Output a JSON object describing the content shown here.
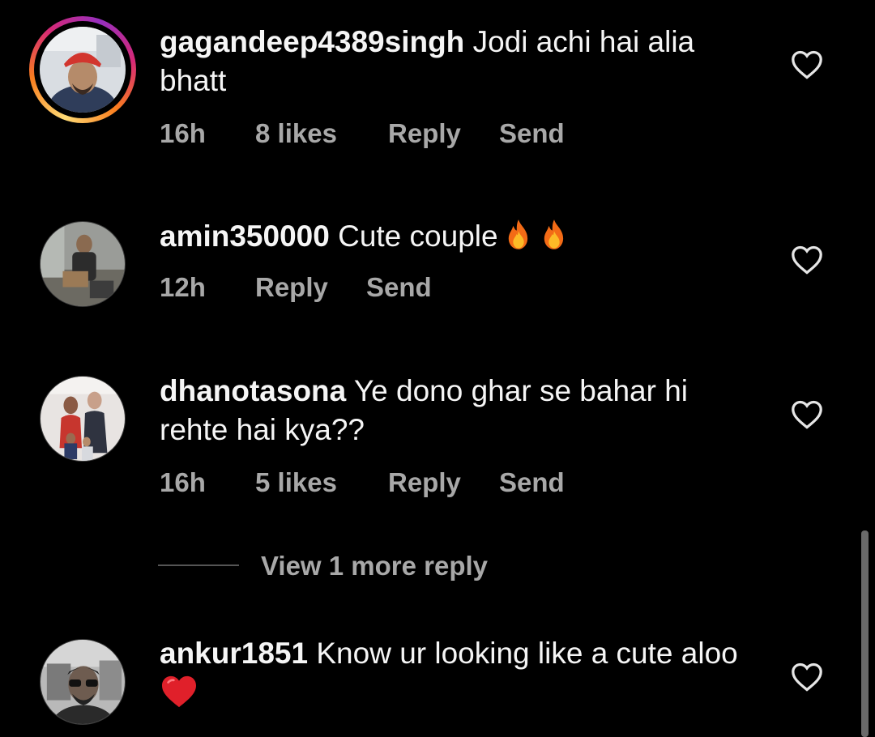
{
  "comments": [
    {
      "username": "gagandeep4389singh",
      "text": "Jodi achi hai alia bhatt",
      "time": "16h",
      "likes": "8 likes",
      "reply": "Reply",
      "send": "Send",
      "has_story": true
    },
    {
      "username": "amin350000",
      "text": "Cute couple",
      "time": "12h",
      "reply": "Reply",
      "send": "Send",
      "emoji": [
        "fire",
        "fire"
      ]
    },
    {
      "username": "dhanotasona",
      "text": "Ye dono ghar se bahar hi rehte hai kya??",
      "time": "16h",
      "likes": "5 likes",
      "reply": "Reply",
      "send": "Send",
      "view_more": "View 1 more reply"
    },
    {
      "username": "ankur1851",
      "text": "Know ur looking like a cute aloo",
      "emoji": [
        "red-heart"
      ]
    }
  ],
  "colors": {
    "background": "#000000",
    "primary_text": "#f5f5f5",
    "secondary_text": "#a8a8a8"
  },
  "icons": [
    "heart-outline-icon",
    "fire-emoji",
    "red-heart-emoji"
  ]
}
